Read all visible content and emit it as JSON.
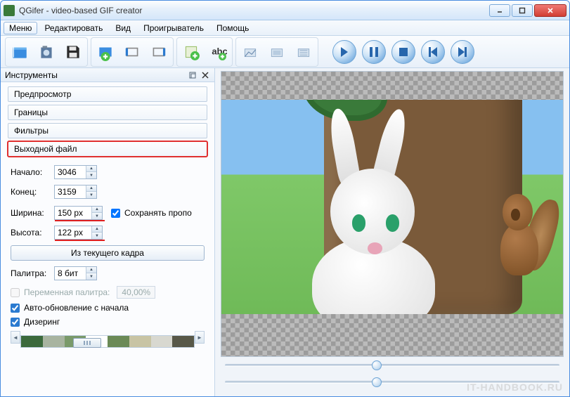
{
  "window": {
    "title": "QGifer - video-based GIF creator"
  },
  "menu": {
    "items": [
      "Меню",
      "Редактировать",
      "Вид",
      "Проигрыватель",
      "Помощь"
    ]
  },
  "toolbar": {
    "open_icon": "open-video-icon",
    "render_icon": "render-gif-icon",
    "save_icon": "save-icon",
    "marker_icon": "marker-icon",
    "mark_start_icon": "mark-start-icon",
    "mark_end_icon": "mark-end-icon",
    "add_object_icon": "add-object-icon",
    "text_icon": "text-icon",
    "filter1_icon": "filter-a-icon",
    "filter2_icon": "filter-b-icon",
    "filter3_icon": "filter-c-icon"
  },
  "player": {
    "play": "play",
    "pause": "pause",
    "stop": "stop",
    "prev": "prev-frame",
    "next": "next-frame"
  },
  "sidebar": {
    "title": "Инструменты",
    "sections": {
      "preview": "Предпросмотр",
      "bounds": "Границы",
      "filters": "Фильтры",
      "output": "Выходной файл"
    },
    "form": {
      "start_label": "Начало:",
      "start_value": "3046",
      "end_label": "Конец:",
      "end_value": "3159",
      "width_label": "Ширина:",
      "width_value": "150 px",
      "height_label": "Высота:",
      "height_value": "122 px",
      "keep_ratio_label": "Сохранять пропо",
      "from_frame_btn": "Из текущего кадра",
      "palette_label": "Палитра:",
      "palette_value": "8 бит",
      "var_palette_label": "Переменная палитра:",
      "var_palette_pct": "40,00%",
      "auto_update_label": "Авто-обновление с начала",
      "dithering_label": "Дизеринг"
    },
    "palette_colors": [
      "#3c6a3c",
      "#a8b4a0",
      "#7a9a6a",
      "#ffffff",
      "#6b8a56",
      "#c8c4a4",
      "#d8d8d0",
      "#585848"
    ]
  },
  "watermark": "IT-HANDBOOK.RU"
}
